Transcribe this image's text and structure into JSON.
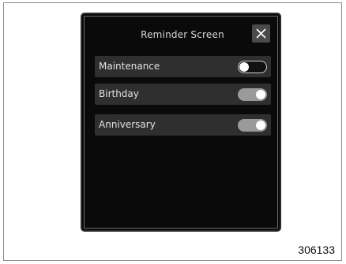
{
  "screen": {
    "title": "Reminder Screen",
    "close_icon": "close-icon"
  },
  "reminders": [
    {
      "label": "Maintenance",
      "enabled": false
    },
    {
      "label": "Birthday",
      "enabled": true
    },
    {
      "label": "Anniversary",
      "enabled": true
    }
  ],
  "figure_number": "306133",
  "colors": {
    "screen_bg": "#0a0a0a",
    "row_bg": "#2f2f2f",
    "toggle_on": "#9a9a9a",
    "text": "#e2e2e2"
  }
}
